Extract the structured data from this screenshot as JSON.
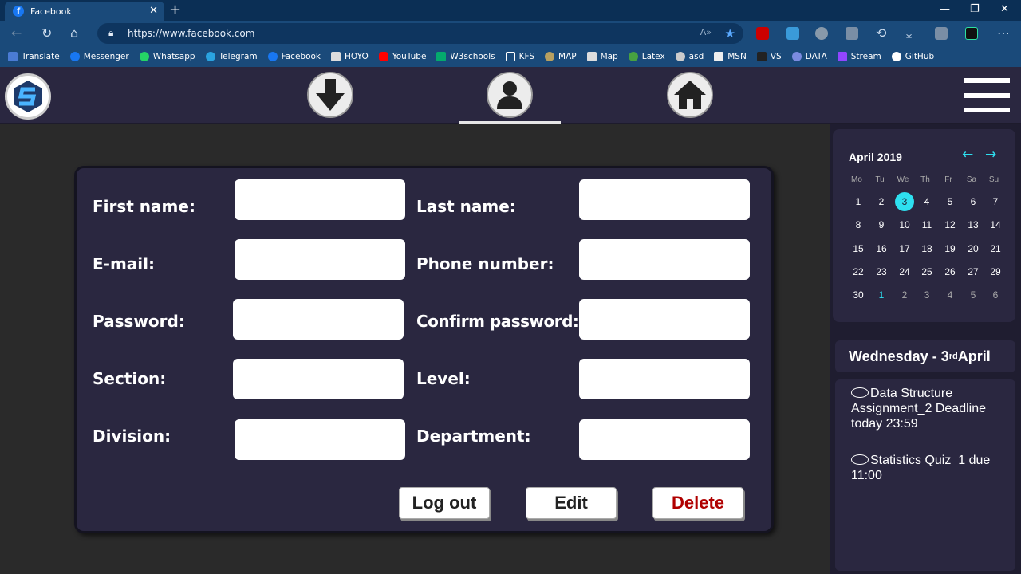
{
  "browser": {
    "tab_title": "Facebook",
    "url": "https://www.facebook.com",
    "bookmarks": [
      "Translate",
      "Messenger",
      "Whatsapp",
      "Telegram",
      "Facebook",
      "HOYO",
      "YouTube",
      "W3schools",
      "KFS",
      "MAP",
      "Map",
      "Latex",
      "asd",
      "MSN",
      "VS",
      "DATA",
      "Stream",
      "GitHub"
    ]
  },
  "form": {
    "first_name": "First name:",
    "last_name": "Last name:",
    "email": "E-mail:",
    "phone": "Phone number:",
    "password": "Password:",
    "confirm_password": "Confirm password:",
    "section": "Section:",
    "level": "Level:",
    "division": "Division:",
    "department": "Department:",
    "logout": "Log out",
    "edit": "Edit",
    "delete": "Delete"
  },
  "calendar": {
    "title": "April 2019",
    "prev": "←",
    "next": "→",
    "weekdays": [
      "Mo",
      "Tu",
      "We",
      "Th",
      "Fr",
      "Sa",
      "Su"
    ],
    "weeks": [
      [
        "1",
        "2",
        "3",
        "4",
        "5",
        "6",
        "7"
      ],
      [
        "8",
        "9",
        "10",
        "11",
        "12",
        "13",
        "14"
      ],
      [
        "15",
        "16",
        "17",
        "18",
        "19",
        "20",
        "21"
      ],
      [
        "22",
        "23",
        "24",
        "25",
        "26",
        "27",
        "29"
      ],
      [
        "30",
        "1",
        "2",
        "3",
        "4",
        "5",
        "6"
      ]
    ]
  },
  "sidebar": {
    "day_name": "Wednesday  -  3",
    "day_suffix": "rd",
    "month": " April",
    "events": [
      "Data Structure Assignment_2 Deadline today 23:59",
      "Statistics Quiz_1 due 11:00"
    ]
  },
  "colors": {
    "accent": "#2ee0f0",
    "panel": "#2a2740",
    "delete": "#b00000"
  }
}
